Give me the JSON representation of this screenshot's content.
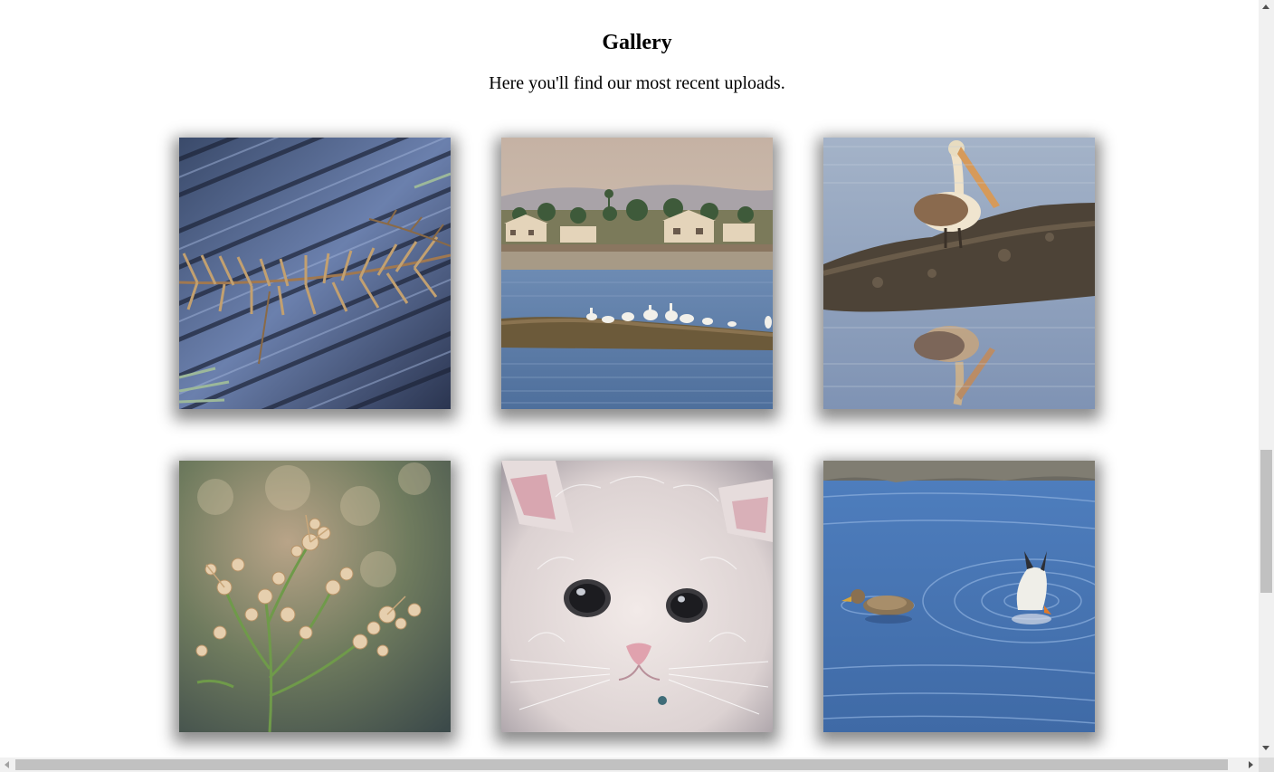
{
  "gallery": {
    "title": "Gallery",
    "subtitle": "Here you'll find our most recent uploads."
  },
  "photos": [
    {
      "subject": "pine-needles-on-wet-wood"
    },
    {
      "subject": "pelicans-on-marsh-island"
    },
    {
      "subject": "pelican-on-rock-reflection"
    },
    {
      "subject": "dried-wildflowers"
    },
    {
      "subject": "white-kitten"
    },
    {
      "subject": "ducks-in-water"
    }
  ]
}
